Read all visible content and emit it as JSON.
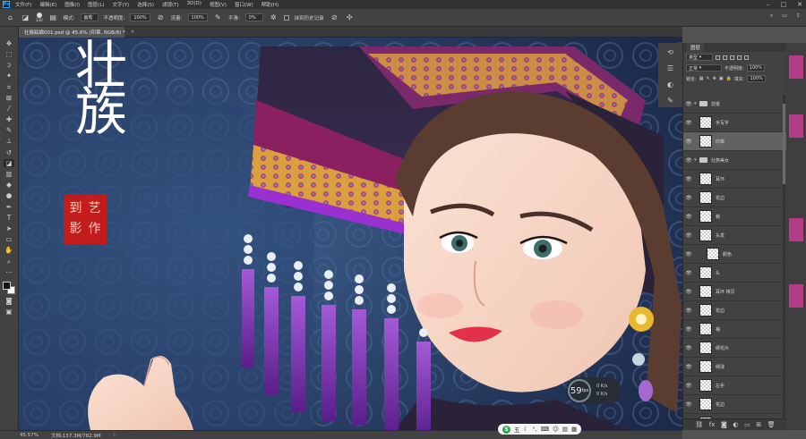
{
  "menubar": {
    "logo": "Ps",
    "items": [
      "文件(F)",
      "编辑(E)",
      "图像(I)",
      "图层(L)",
      "文字(Y)",
      "选择(S)",
      "滤镜(T)",
      "3D(D)",
      "视图(V)",
      "窗口(W)",
      "帮助(H)"
    ]
  },
  "options": {
    "brush_size": "330",
    "mode_label": "模式:",
    "mode_value": "画笔",
    "opacity_label": "不透明度:",
    "opacity_value": "100%",
    "flow_label": "流量:",
    "flow_value": "100%",
    "smooth_label": "平滑:",
    "smooth_value": "0%",
    "history_label": "抹到历史记录"
  },
  "document": {
    "tab_title": "壮族姑娘001.psd @ 45.6% (印章, RGB/8) *"
  },
  "artwork": {
    "calligraphy": "壮族",
    "seal_chars": [
      "到",
      "艺",
      "影",
      "作"
    ]
  },
  "status": {
    "zoom": "45.57%",
    "doc_info": "文档:157.3M/782.9M"
  },
  "ime": {
    "logo": "S",
    "mode": "五"
  },
  "fps": {
    "value": "59",
    "unit": "fps",
    "up": "0 K/s",
    "down": "0 K/s"
  },
  "layers_panel": {
    "title": "图层",
    "filter_type": "类型",
    "blend_mode": "正常",
    "opacity_label": "不透明度:",
    "opacity_value": "100%",
    "lock_label": "锁定:",
    "fill_label": "填充:",
    "fill_value": "100%",
    "layers": [
      {
        "name": "前景",
        "kind": "group",
        "indent": 0,
        "selected": false
      },
      {
        "name": "手写字",
        "kind": "layer",
        "indent": 1,
        "selected": false
      },
      {
        "name": "印章",
        "kind": "layer",
        "indent": 1,
        "selected": true
      },
      {
        "name": "壮族美女",
        "kind": "group",
        "indent": 0,
        "selected": false
      },
      {
        "name": "耳环",
        "kind": "layer",
        "indent": 1,
        "selected": false
      },
      {
        "name": "花边",
        "kind": "layer",
        "indent": 1,
        "selected": false
      },
      {
        "name": "帽",
        "kind": "layer",
        "indent": 1,
        "selected": false
      },
      {
        "name": "头发",
        "kind": "layer",
        "indent": 1,
        "selected": false
      },
      {
        "name": "颜色",
        "kind": "layer",
        "indent": 2,
        "selected": false
      },
      {
        "name": "头",
        "kind": "layer",
        "indent": 1,
        "selected": false
      },
      {
        "name": "耳环 拷贝",
        "kind": "layer",
        "indent": 1,
        "selected": false
      },
      {
        "name": "花边",
        "kind": "layer",
        "indent": 1,
        "selected": false
      },
      {
        "name": "袖",
        "kind": "layer",
        "indent": 1,
        "selected": false
      },
      {
        "name": "绣花片",
        "kind": "layer",
        "indent": 1,
        "selected": false
      },
      {
        "name": "绣球",
        "kind": "layer",
        "indent": 1,
        "selected": false
      },
      {
        "name": "左手",
        "kind": "layer",
        "indent": 1,
        "selected": false
      },
      {
        "name": "花边",
        "kind": "layer",
        "indent": 1,
        "selected": false
      },
      {
        "name": "花边",
        "kind": "layer",
        "indent": 1,
        "selected": false
      },
      {
        "name": "腰带",
        "kind": "layer",
        "indent": 1,
        "selected": false
      }
    ]
  }
}
